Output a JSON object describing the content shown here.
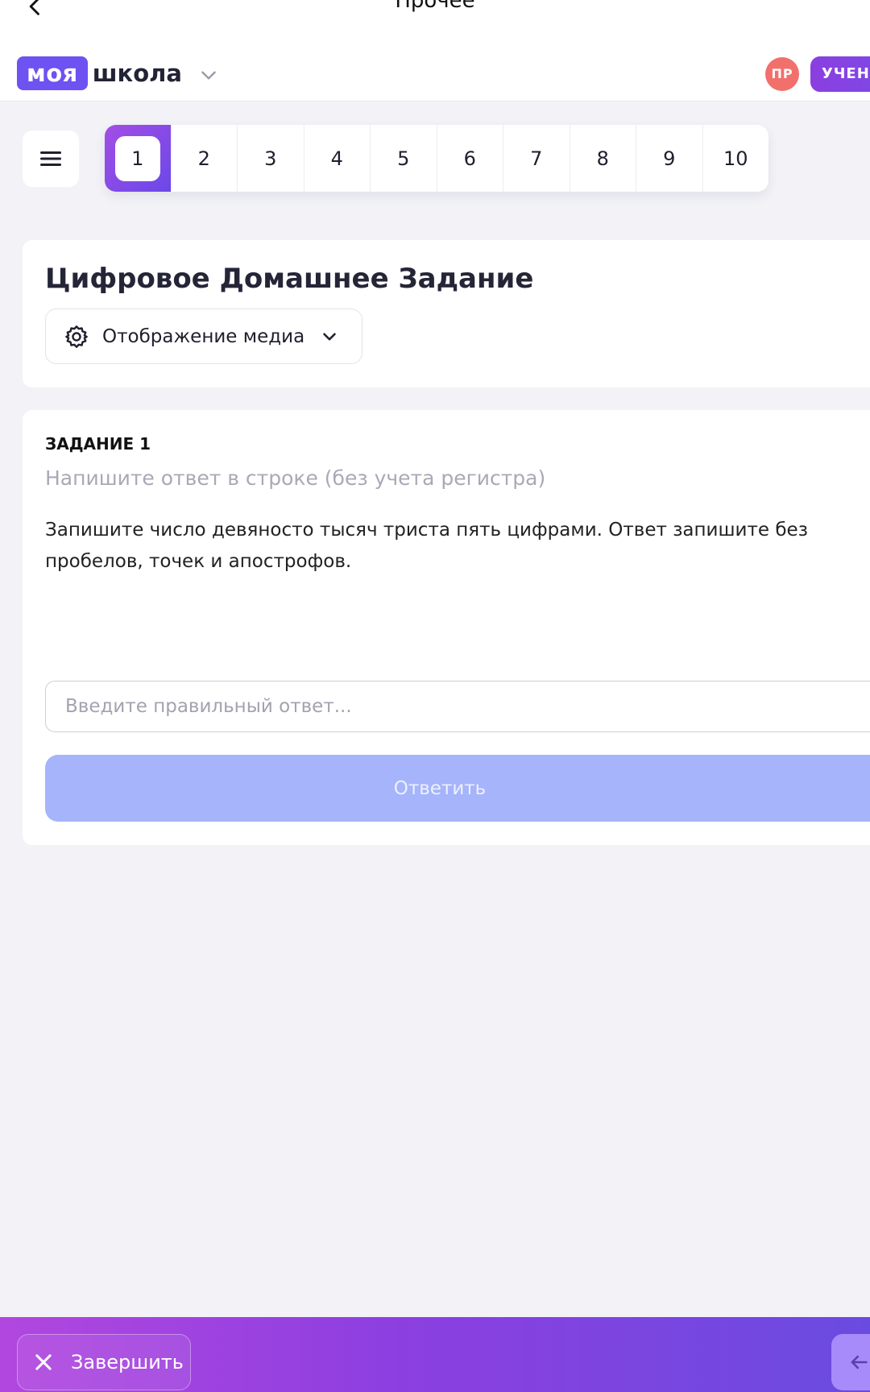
{
  "topbar": {
    "title": "Прочее",
    "logo_box": "моя",
    "logo_word": "школа",
    "avatar_initials": "ПР",
    "role": "УЧЕНИК"
  },
  "nav": {
    "pages": [
      "1",
      "2",
      "3",
      "4",
      "5",
      "6",
      "7",
      "8",
      "9",
      "10"
    ],
    "active_page": "1"
  },
  "homework": {
    "title": "Цифровое Домашнее Задание",
    "media_label": "Отображение медиа"
  },
  "task": {
    "number": "ЗАДАНИЕ 1",
    "hint": "Напишите ответ в строке (без учета регистра)",
    "text": "Запишите число девяносто тысяч триста пять цифрами. Ответ запишите без пробелов, точек и апострофов.",
    "answer_value": "",
    "answer_placeholder": "Введите правильный ответ...",
    "submit_label": "Ответить"
  },
  "bottom": {
    "finish_label": "Завершить"
  },
  "icons": {
    "back": "chevron-left-icon",
    "logo_dropdown": "chevron-down-icon",
    "menu": "hamburger-icon",
    "media": "gear-icon",
    "media_dropdown": "chevron-down-icon",
    "finish": "close-icon",
    "prev": "arrow-left-icon"
  },
  "colors": {
    "brand": "#6e52f2",
    "avatar": "#f2706c",
    "submit_disabled": "#a5b4fb",
    "bottom_gradient_start": "#b147df",
    "bottom_gradient_end": "#6a4be0"
  }
}
